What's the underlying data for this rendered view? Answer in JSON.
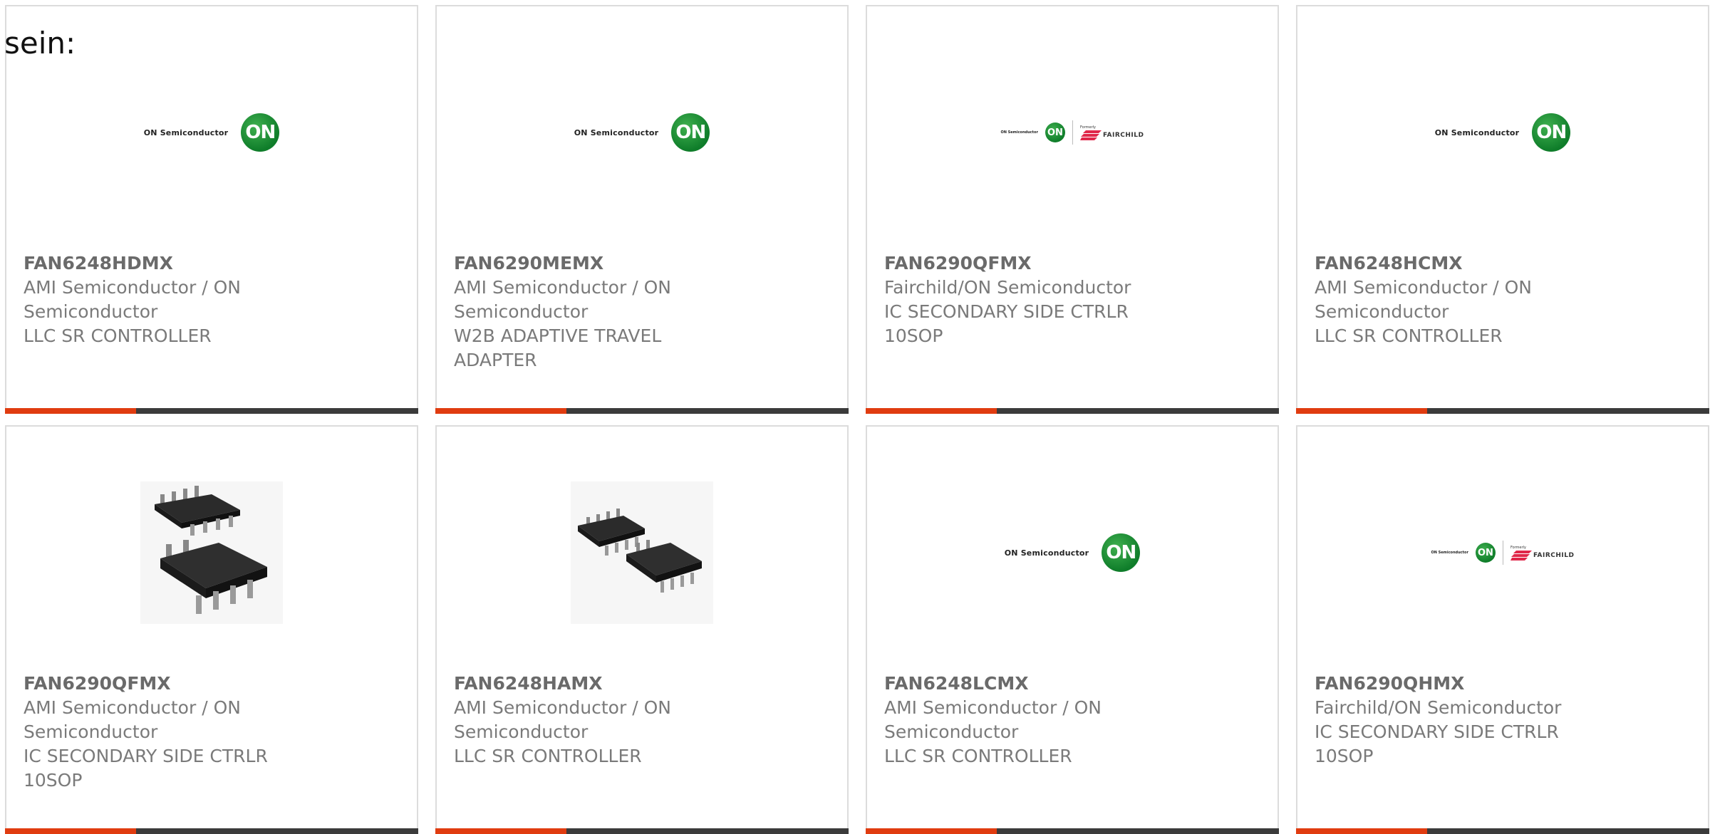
{
  "intro_text": "sein:",
  "logos": {
    "on_wordmark": "ON Semiconductor",
    "on_badge": "ON",
    "fairchild_formerly": "Formerly",
    "fairchild_name": "FAIRCHILD"
  },
  "colors": {
    "accent": "#e03c10",
    "bar": "#3b3b3b",
    "text": "#7a7a7a",
    "on_green": "#1a8a35"
  },
  "products": [
    {
      "part": "FAN6248HDMX",
      "manufacturer": "AMI Semiconductor / ON Semiconductor",
      "desc": "LLC SR CONTROLLER",
      "image": "on-semiconductor-logo"
    },
    {
      "part": "FAN6290MEMX",
      "manufacturer": "AMI Semiconductor / ON Semiconductor",
      "desc": "W2B ADAPTIVE TRAVEL ADAPTER",
      "image": "on-semiconductor-logo"
    },
    {
      "part": "FAN6290QFMX",
      "manufacturer": "Fairchild/ON Semiconductor",
      "desc": "IC SECONDARY SIDE CTRLR 10SOP",
      "image": "on-fairchild-logo"
    },
    {
      "part": "FAN6248HCMX",
      "manufacturer": "AMI Semiconductor / ON Semiconductor",
      "desc": "LLC SR CONTROLLER",
      "image": "on-semiconductor-logo"
    },
    {
      "part": "FAN6290QFMX",
      "manufacturer": "AMI Semiconductor / ON Semiconductor",
      "desc": "IC SECONDARY SIDE CTRLR 10SOP",
      "image": "soic-package-photo"
    },
    {
      "part": "FAN6248HAMX",
      "manufacturer": "AMI Semiconductor / ON Semiconductor",
      "desc": "LLC SR CONTROLLER",
      "image": "soic-package-photo"
    },
    {
      "part": "FAN6248LCMX",
      "manufacturer": "AMI Semiconductor / ON Semiconductor",
      "desc": "LLC SR CONTROLLER",
      "image": "on-semiconductor-logo"
    },
    {
      "part": "FAN6290QHMX",
      "manufacturer": "Fairchild/ON Semiconductor",
      "desc": "IC SECONDARY SIDE CTRLR 10SOP",
      "image": "on-fairchild-logo"
    }
  ]
}
